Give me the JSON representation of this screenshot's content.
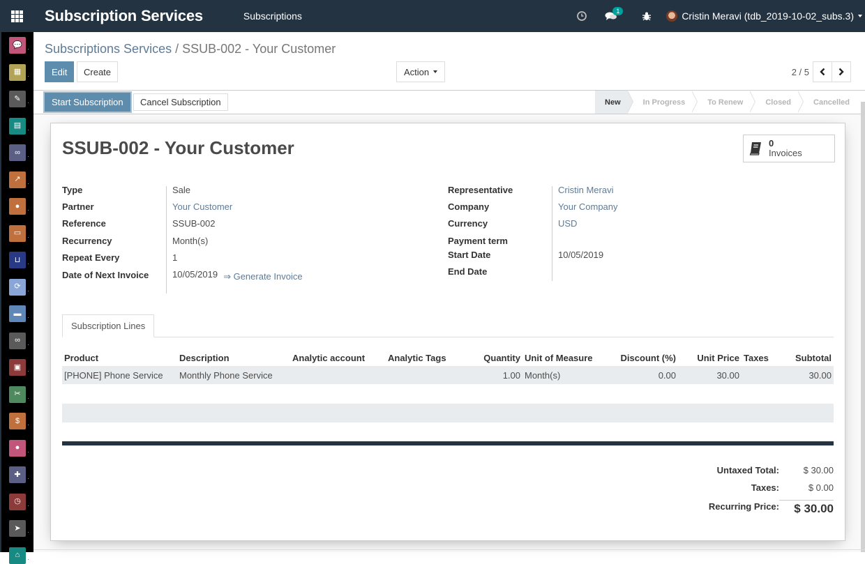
{
  "topbar": {
    "brand": "Subscription Services",
    "menu": "Subscriptions",
    "icons": [
      "clock-icon",
      "chat-icon",
      "bug-icon"
    ],
    "chat_badge": "1",
    "user": "Cristin Meravi (tdb_2019-10-02_subs.3)"
  },
  "sidebar": {
    "items": [
      {
        "name": "discuss",
        "icon": "chat-bubble-icon",
        "color": "#c1567a"
      },
      {
        "name": "calendar",
        "icon": "calendar-icon",
        "color": "#b1a456"
      },
      {
        "name": "notes",
        "icon": "note-icon",
        "color": "#5a5a5a"
      },
      {
        "name": "contacts",
        "icon": "address-book-icon",
        "color": "#178a84"
      },
      {
        "name": "crm",
        "icon": "handshake-icon",
        "color": "#5b5f86"
      },
      {
        "name": "sales",
        "icon": "chart-up-icon",
        "color": "#c0703d"
      },
      {
        "name": "website",
        "icon": "globe-icon",
        "color": "#c0703d"
      },
      {
        "name": "point-of-sale",
        "icon": "wallet-icon",
        "color": "#c0703d"
      },
      {
        "name": "ecommerce",
        "icon": "cart-icon",
        "color": "#283a86"
      },
      {
        "name": "subscriptions",
        "icon": "refresh-icon",
        "color": "#8aa6d8"
      },
      {
        "name": "invoicing",
        "icon": "credit-card-icon",
        "color": "#5f88b8"
      },
      {
        "name": "integrations",
        "icon": "link-icon",
        "color": "#5a5a5a"
      },
      {
        "name": "inventory",
        "icon": "box-icon",
        "color": "#8c3a3a"
      },
      {
        "name": "repair",
        "icon": "wrench-icon",
        "color": "#4f8a5f"
      },
      {
        "name": "expenses",
        "icon": "receipt-icon",
        "color": "#c0703d"
      },
      {
        "name": "payroll",
        "icon": "employee-icon",
        "color": "#c1567a"
      },
      {
        "name": "apps",
        "icon": "puzzle-icon",
        "color": "#5b5f86"
      },
      {
        "name": "timesheets",
        "icon": "stopwatch-icon",
        "color": "#8c3a3a"
      },
      {
        "name": "email-marketing",
        "icon": "paper-plane-icon",
        "color": "#5a5a5a"
      },
      {
        "name": "more",
        "icon": "home-icon",
        "color": "#178a84"
      }
    ]
  },
  "breadcrumb": {
    "parent": "Subscriptions Services",
    "separator": "/",
    "current": "SSUB-002 - Your Customer"
  },
  "toolbar": {
    "edit": "Edit",
    "create": "Create",
    "action": "Action",
    "pager": "2 / 5"
  },
  "statusbar": {
    "buttons": {
      "start": "Start Subscription",
      "cancel": "Cancel Subscription"
    },
    "stages": [
      "New",
      "In Progress",
      "To Renew",
      "Closed",
      "Cancelled"
    ],
    "active_stage": "New"
  },
  "record": {
    "title": "SSUB-002 - Your Customer",
    "invoices_count": "0",
    "invoices_label": "Invoices",
    "left_fields": [
      {
        "label": "Type",
        "value": "Sale"
      },
      {
        "label": "Partner",
        "value": "Your Customer"
      },
      {
        "label": "Reference",
        "value": "SSUB-002"
      },
      {
        "label": "Recurrency",
        "value": "Month(s)"
      },
      {
        "label": "Repeat Every",
        "value": "1"
      },
      {
        "label": "Date of Next Invoice",
        "value": "10/05/2019"
      }
    ],
    "generate_invoice": "⇒ Generate Invoice",
    "right_fields": [
      {
        "label": "Representative",
        "value": "Cristin Meravi"
      },
      {
        "label": "Company",
        "value": "Your Company"
      },
      {
        "label": "Currency",
        "value": "USD"
      },
      {
        "label": "Payment term",
        "value": ""
      },
      {
        "label": "Start Date",
        "value": "10/05/2019"
      },
      {
        "label": "End Date",
        "value": ""
      }
    ]
  },
  "notebook": {
    "tab": "Subscription Lines",
    "columns": [
      "Product",
      "Description",
      "Analytic account",
      "Analytic Tags",
      "Quantity",
      "Unit of Measure",
      "Discount (%)",
      "Unit Price",
      "Taxes",
      "Subtotal"
    ],
    "rows": [
      [
        "[PHONE] Phone Service",
        "Monthly Phone Service",
        "",
        "",
        "1.00",
        "Month(s)",
        "0.00",
        "30.00",
        "",
        "30.00"
      ]
    ]
  },
  "totals": {
    "untaxed_label": "Untaxed Total:",
    "untaxed_value": "$ 30.00",
    "taxes_label": "Taxes:",
    "taxes_value": "$ 0.00",
    "recurring_label": "Recurring Price:",
    "recurring_value": "$ 30.00"
  }
}
